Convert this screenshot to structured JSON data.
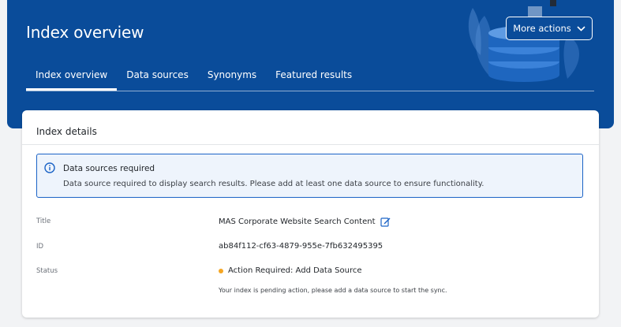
{
  "header": {
    "title": "Index overview",
    "more_actions_label": "More actions",
    "tabs": [
      {
        "label": "Index overview",
        "active": true
      },
      {
        "label": "Data sources",
        "active": false
      },
      {
        "label": "Synonyms",
        "active": false
      },
      {
        "label": "Featured results",
        "active": false
      }
    ]
  },
  "card": {
    "title": "Index details",
    "alert": {
      "icon": "info-icon",
      "title": "Data sources required",
      "body": "Data source required to display search results. Please add at least one data source to ensure functionality."
    },
    "details": {
      "title_label": "Title",
      "title_value": "MAS Corporate Website Search Content",
      "id_label": "ID",
      "id_value": "ab84f112-cf63-4879-955e-7fb632495395",
      "status_label": "Status",
      "status_value": "Action Required: Add Data Source",
      "status_note": "Your index is pending action, please add a data source to start the sync."
    }
  },
  "colors": {
    "header_bg": "#0a4c9a",
    "alert_border": "#1b63c6",
    "alert_bg": "#eef4fc",
    "status_dot": "#f5a623",
    "edit_icon": "#1b63c6"
  }
}
